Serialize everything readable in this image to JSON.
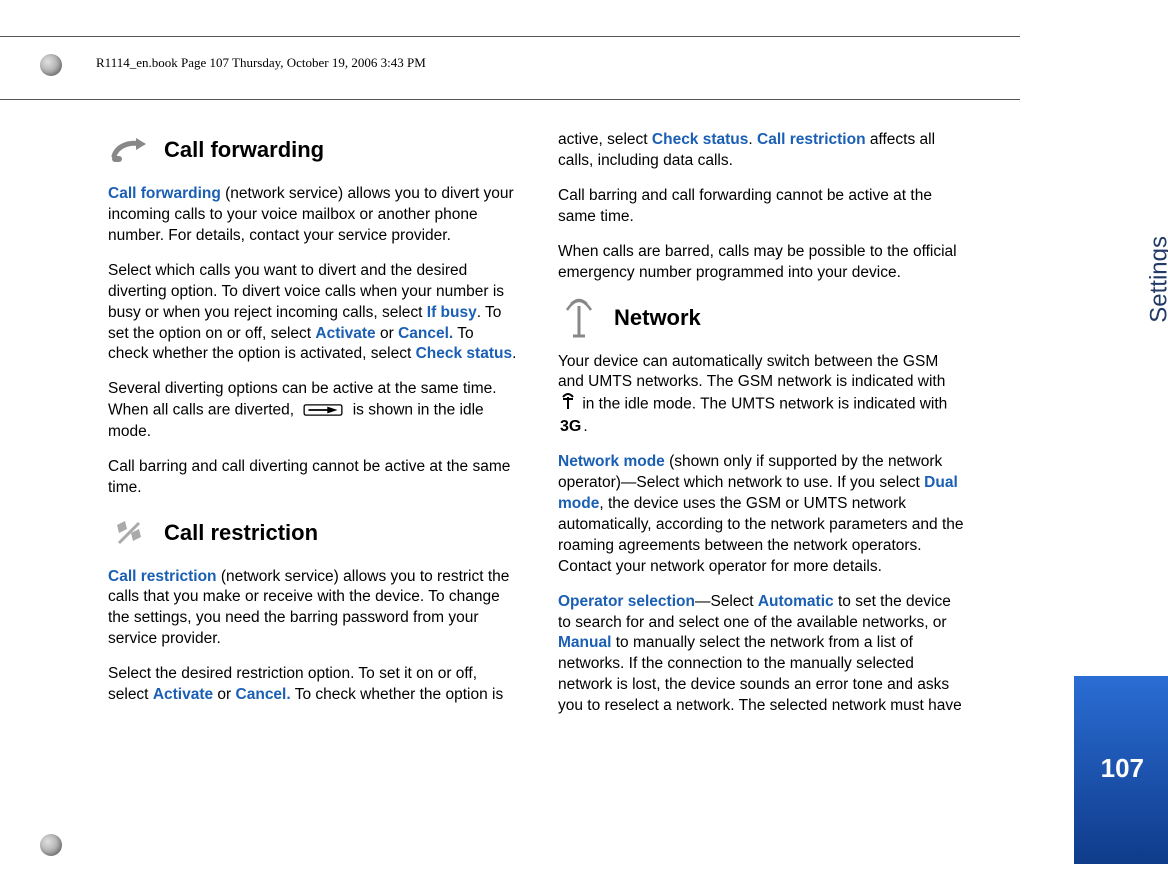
{
  "header": "R1114_en.book  Page 107  Thursday, October 19, 2006  3:43 PM",
  "side_label": "Settings",
  "page_number": "107",
  "sections": {
    "call_forwarding": {
      "title": "Call forwarding",
      "p1a": "Call forwarding",
      "p1b": " (network service) allows you to divert your incoming calls to your voice mailbox or another phone number. For details, contact your service provider.",
      "p2a": "Select which calls you want to divert and the desired diverting option. To divert voice calls when your number is busy or when you reject incoming calls, select ",
      "p2b": "If busy",
      "p2c": ". To set the option on or off, select ",
      "p2d": "Activate",
      "p2e": " or ",
      "p2f": "Cancel.",
      "p2g": " To check whether the option is activated, select ",
      "p2h": "Check status",
      "p2i": ".",
      "p3a": "Several diverting options can be active at the same time. When all calls are diverted, ",
      "p3b": " is shown in the idle mode.",
      "p4": "Call barring and call diverting cannot be active at the same time."
    },
    "call_restriction": {
      "title": "Call restriction",
      "p1a": "Call restriction",
      "p1b": " (network service) allows you to restrict the calls that you make or receive with the device. To change the settings, you need the barring password from your service provider.",
      "p2a": "Select the desired restriction option. To set it on or off, select ",
      "p2b": "Activate",
      "p2c": " or ",
      "p2d": "Cancel.",
      "p2e": " To check whether the option is ",
      "p2f": "active, select ",
      "p2g": "Check status",
      "p2h": ". ",
      "p2i": "Call restriction",
      "p2j": " affects all calls, including data calls.",
      "p3": "Call barring and call forwarding cannot be active at the same time.",
      "p4": "When calls are barred, calls may be possible to the official emergency number programmed into your device."
    },
    "network": {
      "title": "Network",
      "p1a": "Your device can automatically switch between the GSM and UMTS networks. The GSM network is indicated with ",
      "p1b": " in the idle mode. The UMTS network is indicated with ",
      "p1c": ".",
      "p2a": "Network mode",
      "p2b": " (shown only if supported by the network operator)—Select which network to use. If you select ",
      "p2c": "Dual mode",
      "p2d": ", the device uses the GSM or UMTS network automatically, according to the network parameters and the roaming agreements between the network operators. Contact your network operator for more details.",
      "p3a": "Operator selection",
      "p3b": "—Select ",
      "p3c": "Automatic",
      "p3d": " to set the device to search for and select one of the available networks, or ",
      "p3e": "Manual",
      "p3f": " to manually select the network from a list of networks. If the connection to the manually selected network is lost, the device sounds an error tone and asks you to reselect a network. The selected network must have"
    }
  }
}
